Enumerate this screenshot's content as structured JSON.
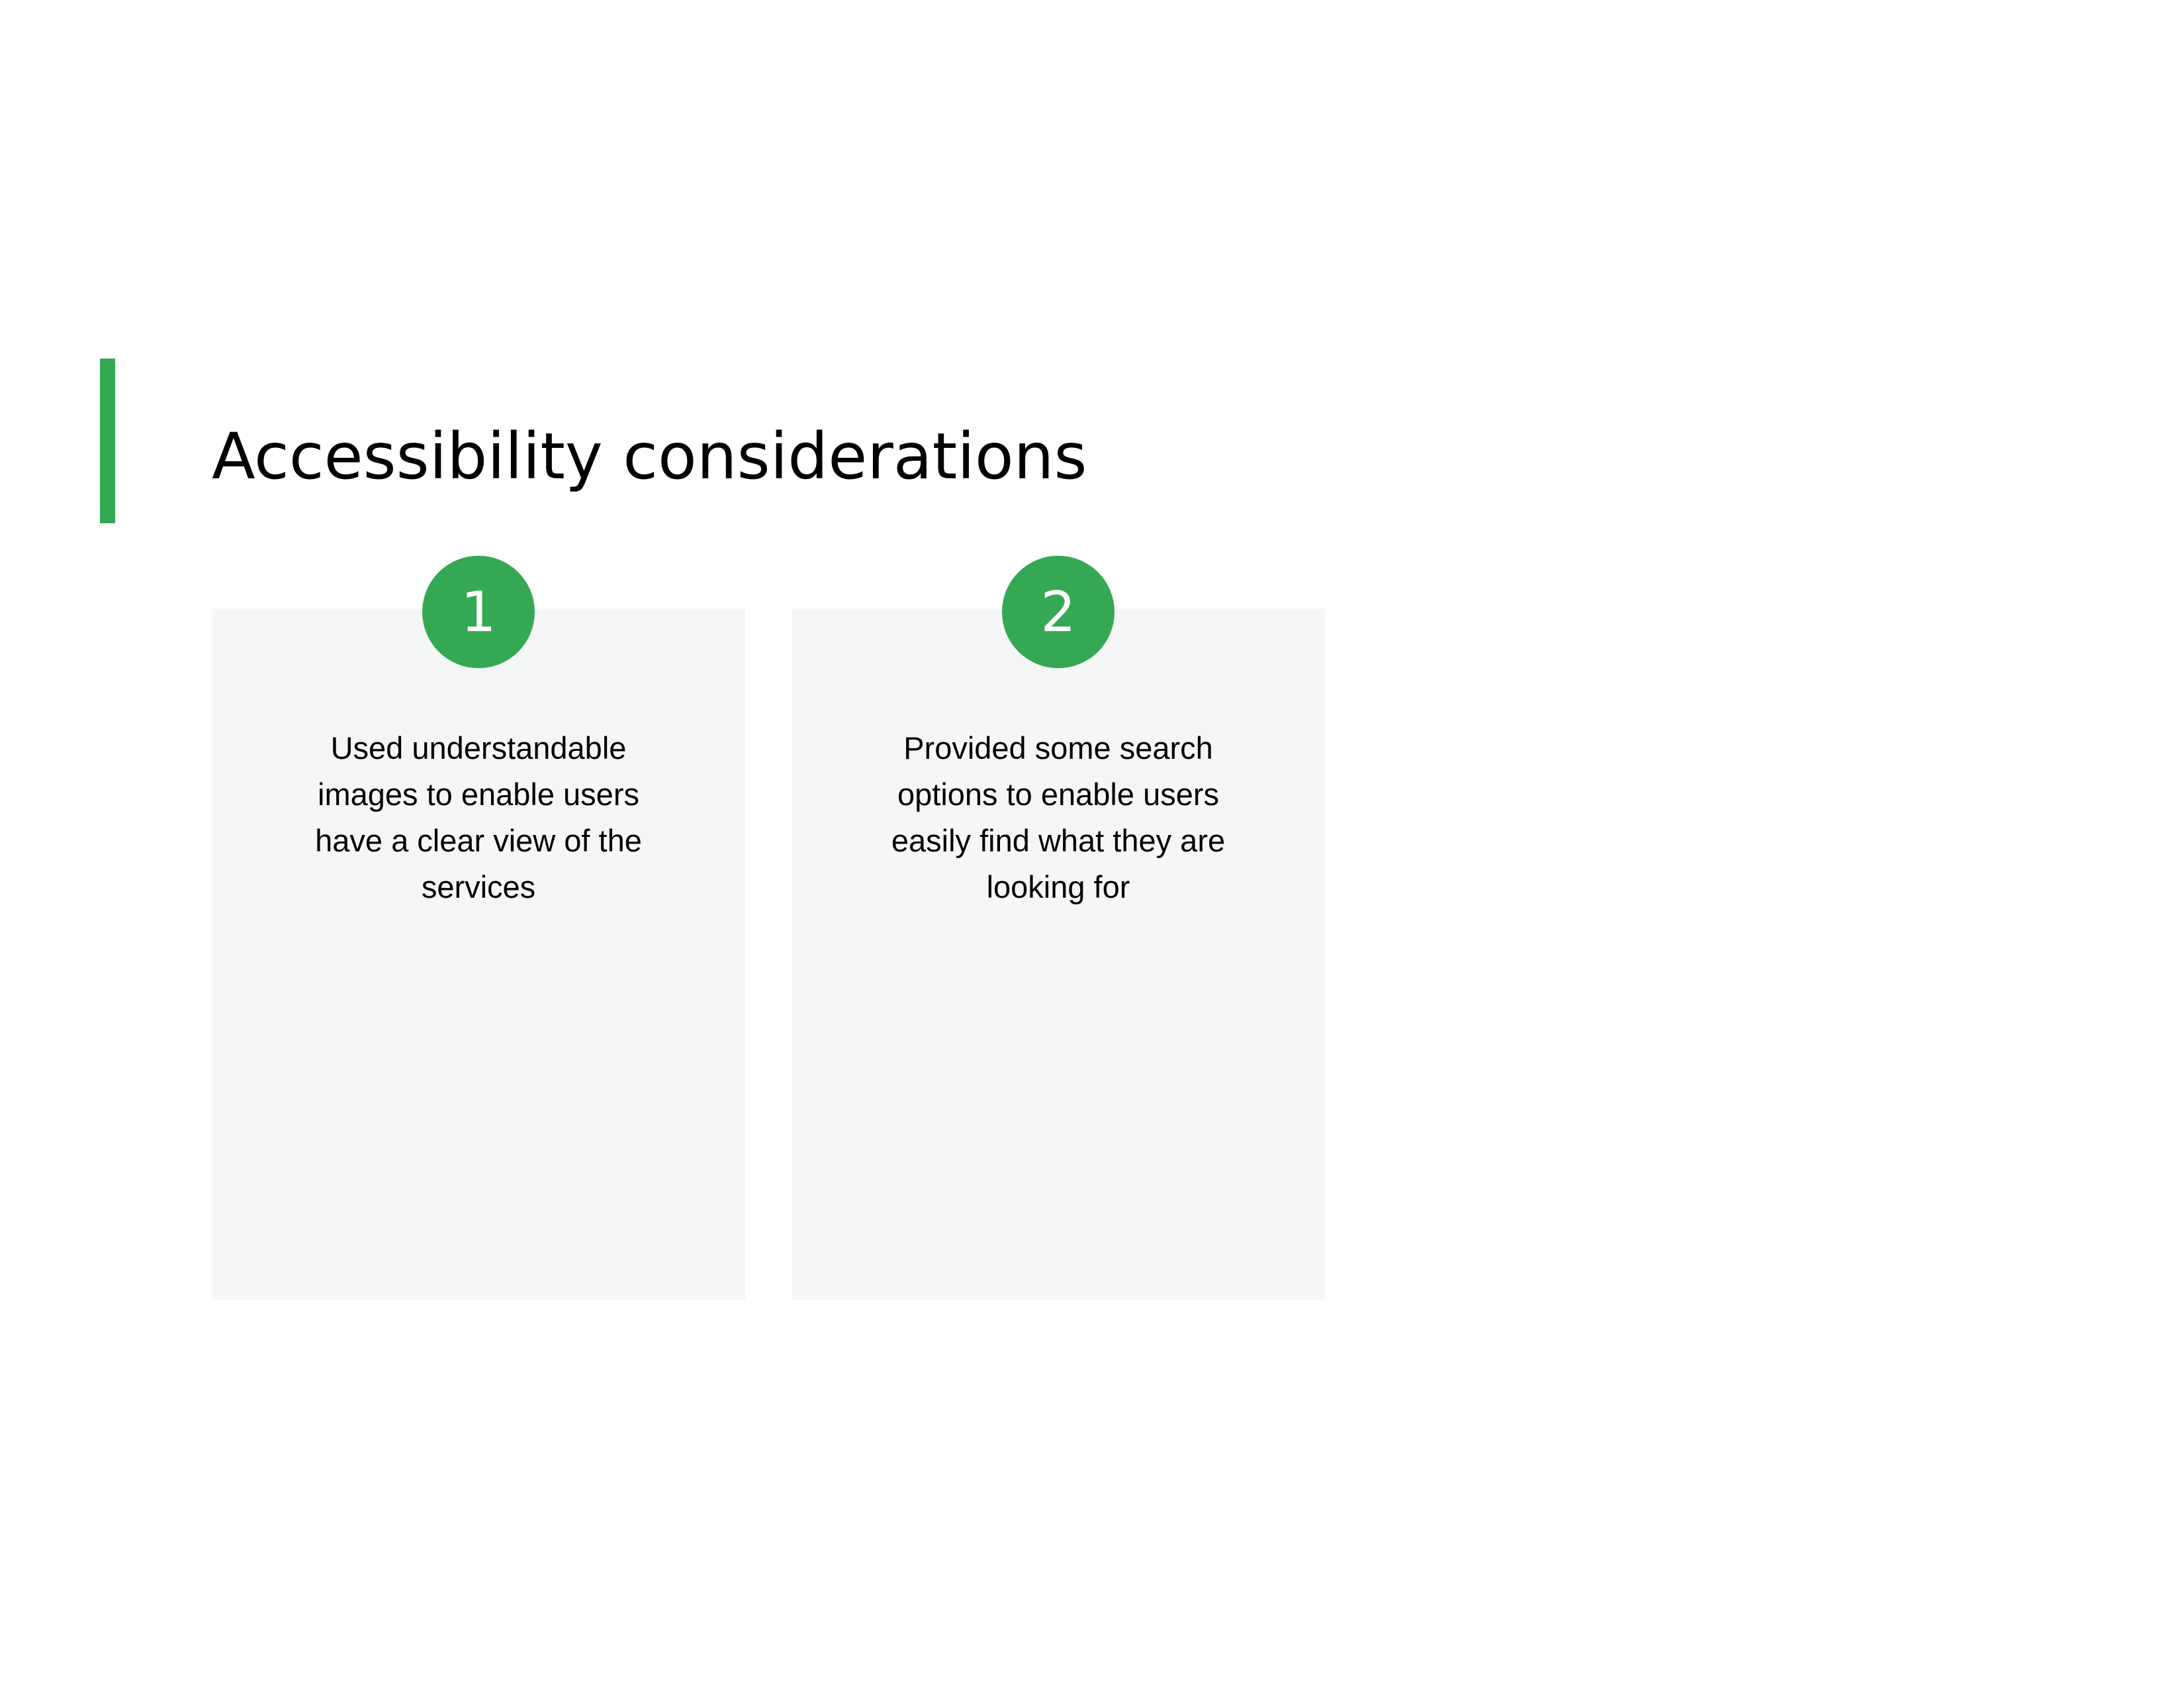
{
  "slide": {
    "title": "Accessibility considerations",
    "accent_color": "#34a853",
    "card_background": "#f5f7f6"
  },
  "cards": [
    {
      "number": "1",
      "text": "Used understandable images to enable users have a clear view of the services"
    },
    {
      "number": "2",
      "text": "Provided some search options to enable users easily find what they are looking for"
    }
  ]
}
